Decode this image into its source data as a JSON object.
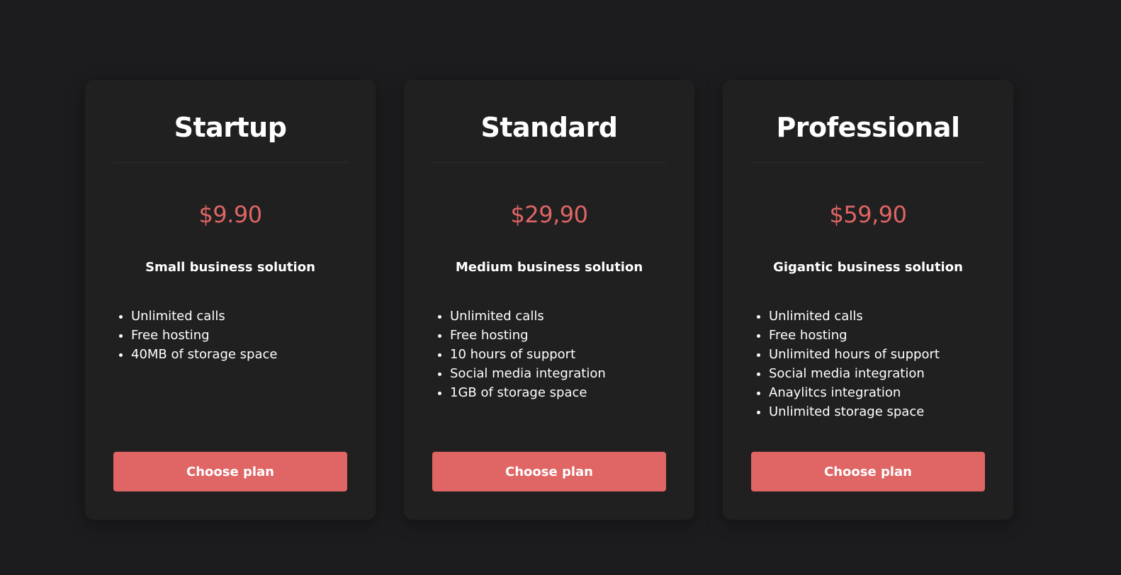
{
  "colors": {
    "background": "#1c1c1e",
    "card": "#202020",
    "accent": "#e06565",
    "text": "#ffffff"
  },
  "plans": [
    {
      "title": "Startup",
      "price": "$9.90",
      "subtitle": "Small business solution",
      "features": [
        "Unlimited calls",
        "Free hosting",
        "40MB of storage space"
      ],
      "button": "Choose plan"
    },
    {
      "title": "Standard",
      "price": "$29,90",
      "subtitle": "Medium business solution",
      "features": [
        "Unlimited calls",
        "Free hosting",
        "10 hours of support",
        "Social media integration",
        "1GB of storage space"
      ],
      "button": "Choose plan"
    },
    {
      "title": "Professional",
      "price": "$59,90",
      "subtitle": "Gigantic business solution",
      "features": [
        "Unlimited calls",
        "Free hosting",
        "Unlimited hours of support",
        "Social media integration",
        "Anaylitcs integration",
        "Unlimited storage space"
      ],
      "button": "Choose plan"
    }
  ]
}
